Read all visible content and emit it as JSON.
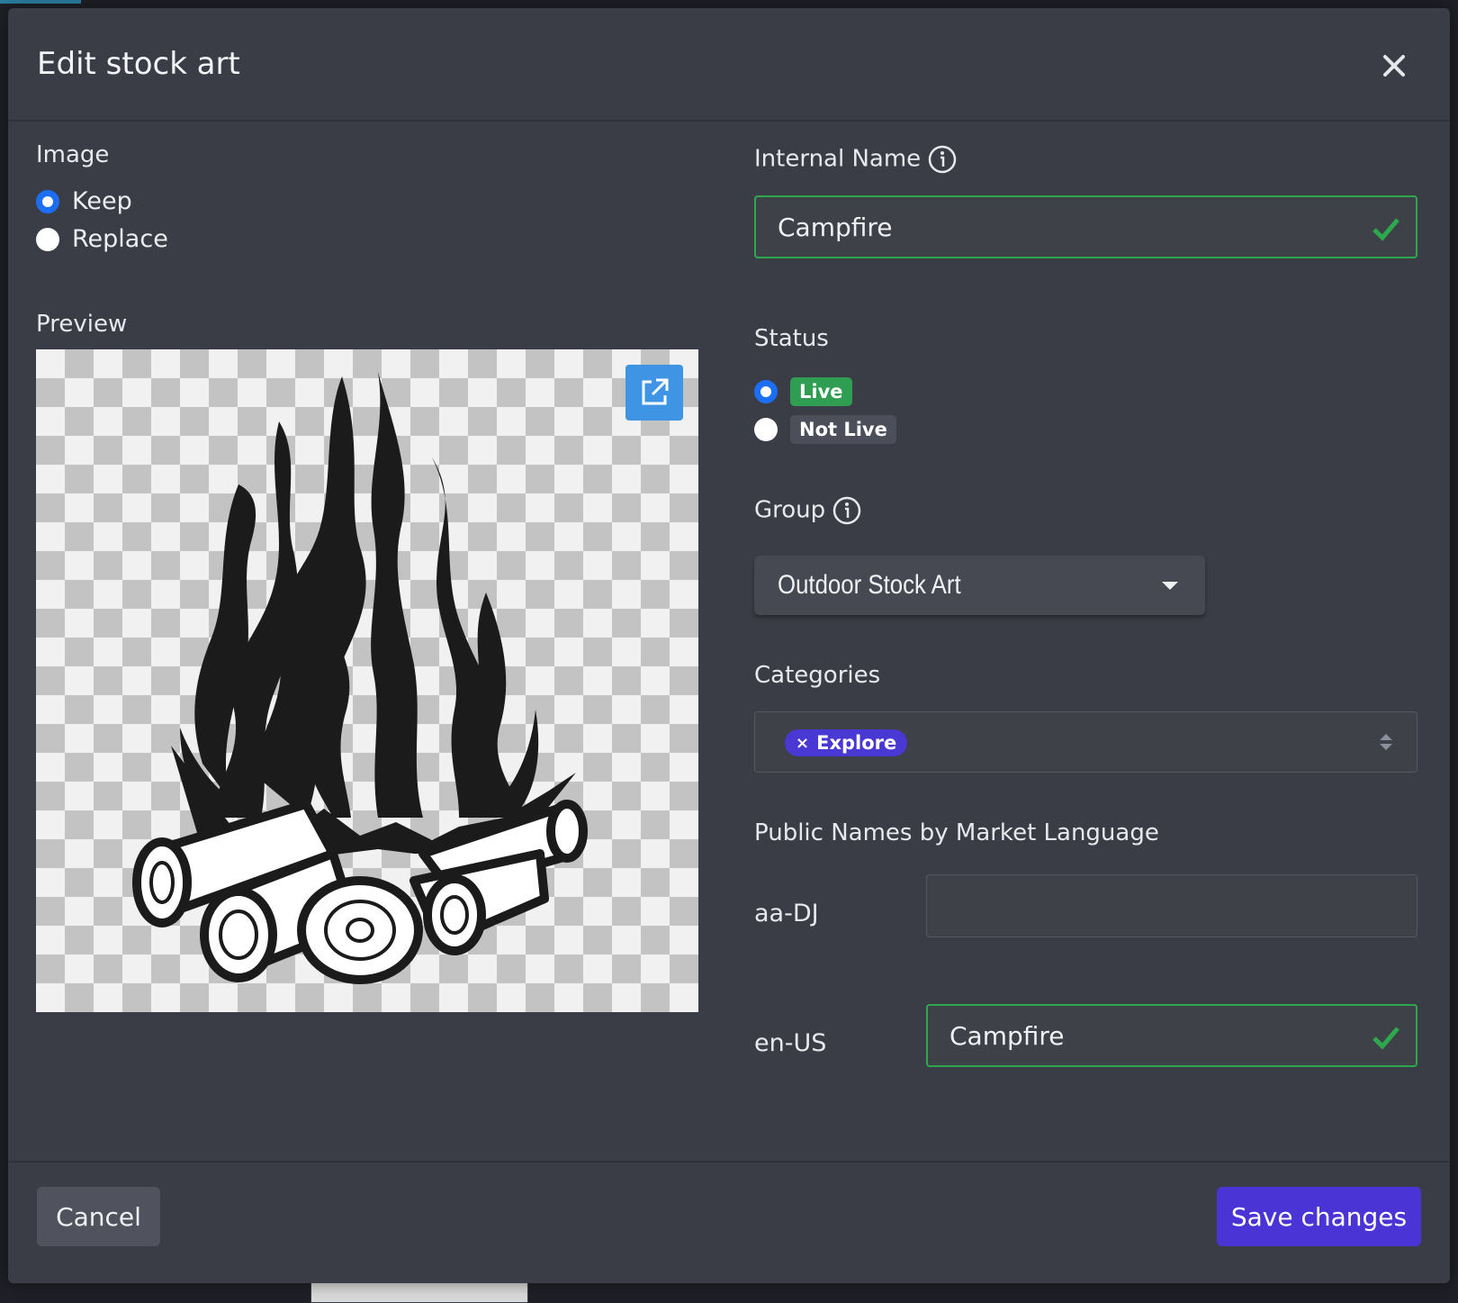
{
  "modal": {
    "title": "Edit stock art",
    "close_label": "×"
  },
  "image_section": {
    "label": "Image",
    "options": [
      {
        "label": "Keep",
        "checked": true
      },
      {
        "label": "Replace",
        "checked": false
      }
    ]
  },
  "preview": {
    "label": "Preview",
    "open_icon": "external-link-icon"
  },
  "internal_name": {
    "label": "Internal Name",
    "value": "Campfire",
    "valid": true
  },
  "status": {
    "label": "Status",
    "options": [
      {
        "label": "Live",
        "checked": true,
        "color": "#2f9e53"
      },
      {
        "label": "Not Live",
        "checked": false,
        "color": "#4c4f5a"
      }
    ]
  },
  "group": {
    "label": "Group",
    "selected": "Outdoor Stock Art"
  },
  "categories": {
    "label": "Categories",
    "chips": [
      {
        "remove": "×",
        "label": "Explore"
      }
    ]
  },
  "public_names": {
    "label": "Public Names by Market Language",
    "rows": [
      {
        "lang": "aa-DJ",
        "value": "",
        "valid": false
      },
      {
        "lang": "en-US",
        "value": "Campfire",
        "valid": true
      }
    ]
  },
  "footer": {
    "cancel_label": "Cancel",
    "save_label": "Save changes"
  },
  "colors": {
    "primary": "#4b34d6",
    "valid": "#2ea84c",
    "radio_accent": "#1c6ef5",
    "modal_bg": "#3b3d46"
  }
}
